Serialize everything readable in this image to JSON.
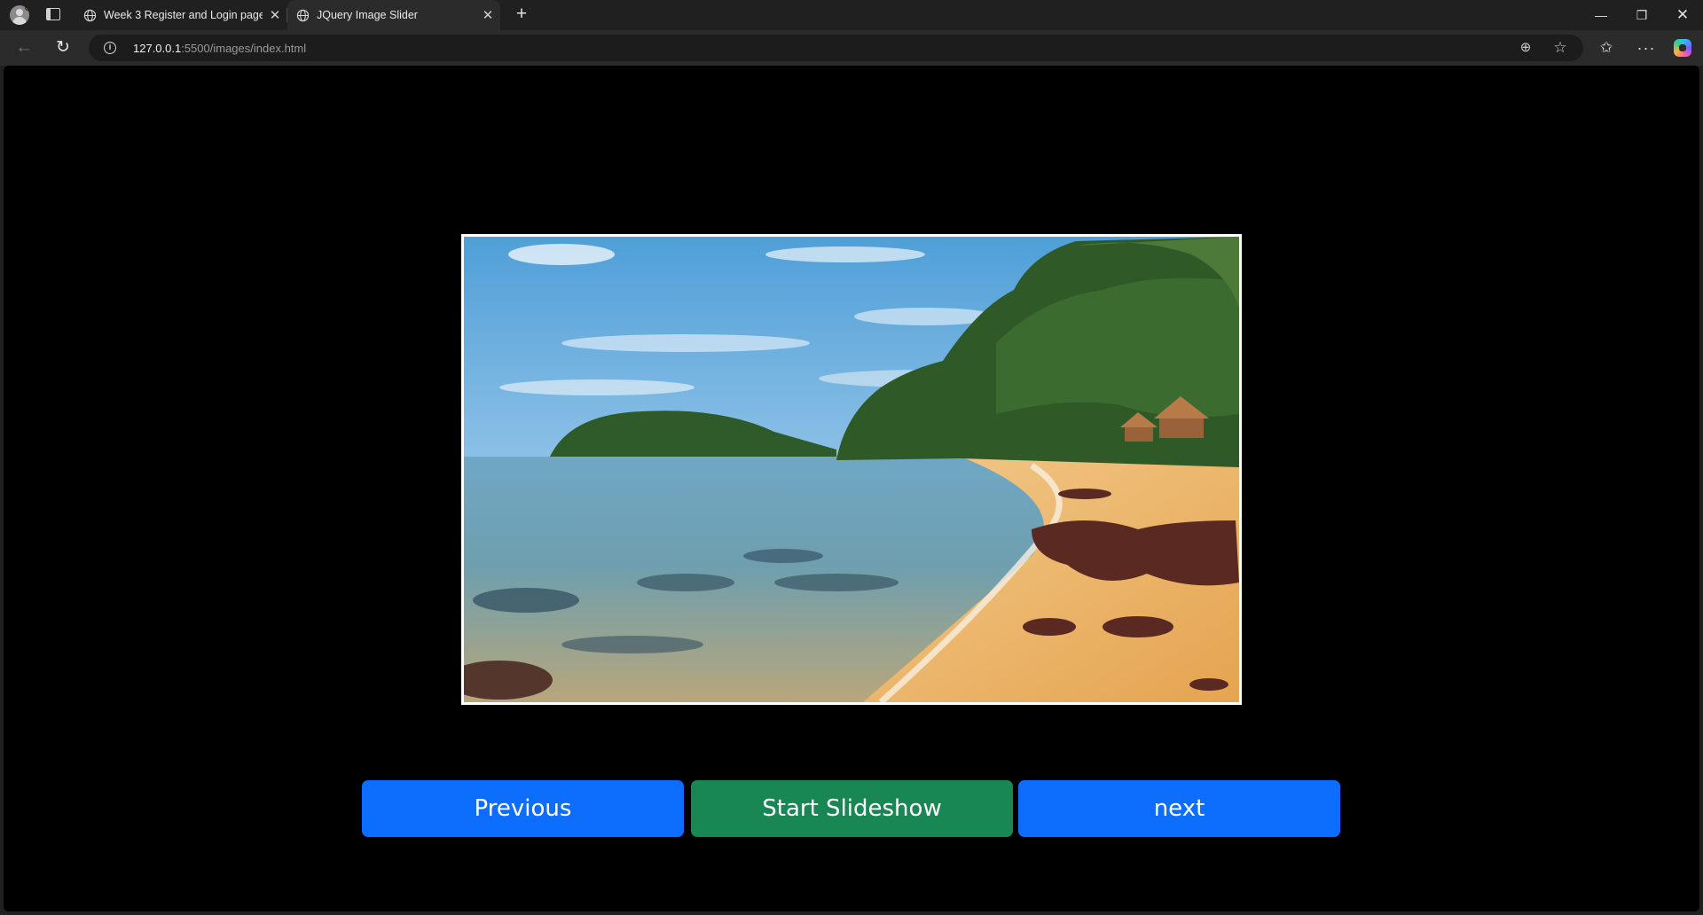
{
  "browser": {
    "tabs": [
      {
        "title": "Week 3 Register and Login page",
        "active": false
      },
      {
        "title": "JQuery Image Slider",
        "active": true
      }
    ],
    "address": {
      "host": "127.0.0.1",
      "rest": ":5500/images/index.html"
    },
    "icons": {
      "profile": "profile-avatar-icon",
      "tab_actions": "tab-actions-icon",
      "globe": "globe-icon",
      "close": "close-icon",
      "new_tab": "plus-icon",
      "back": "back-arrow-icon",
      "reload": "reload-icon",
      "site_info": "info-icon",
      "zoom": "zoom-icon",
      "favorite": "star-icon",
      "favorites": "favorites-icon",
      "more": "more-icon",
      "copilot": "copilot-icon"
    },
    "accent_colors": {
      "page_background": "#000000",
      "chrome_background": "#202020"
    }
  },
  "slider": {
    "image": "tropical beach with turquoise water, golden sand, dark rocks and trees",
    "buttons": {
      "previous": "Previous",
      "start": "Start Slideshow",
      "next": "next"
    },
    "colors": {
      "primary": "#0d6efd",
      "success": "#198754"
    }
  }
}
